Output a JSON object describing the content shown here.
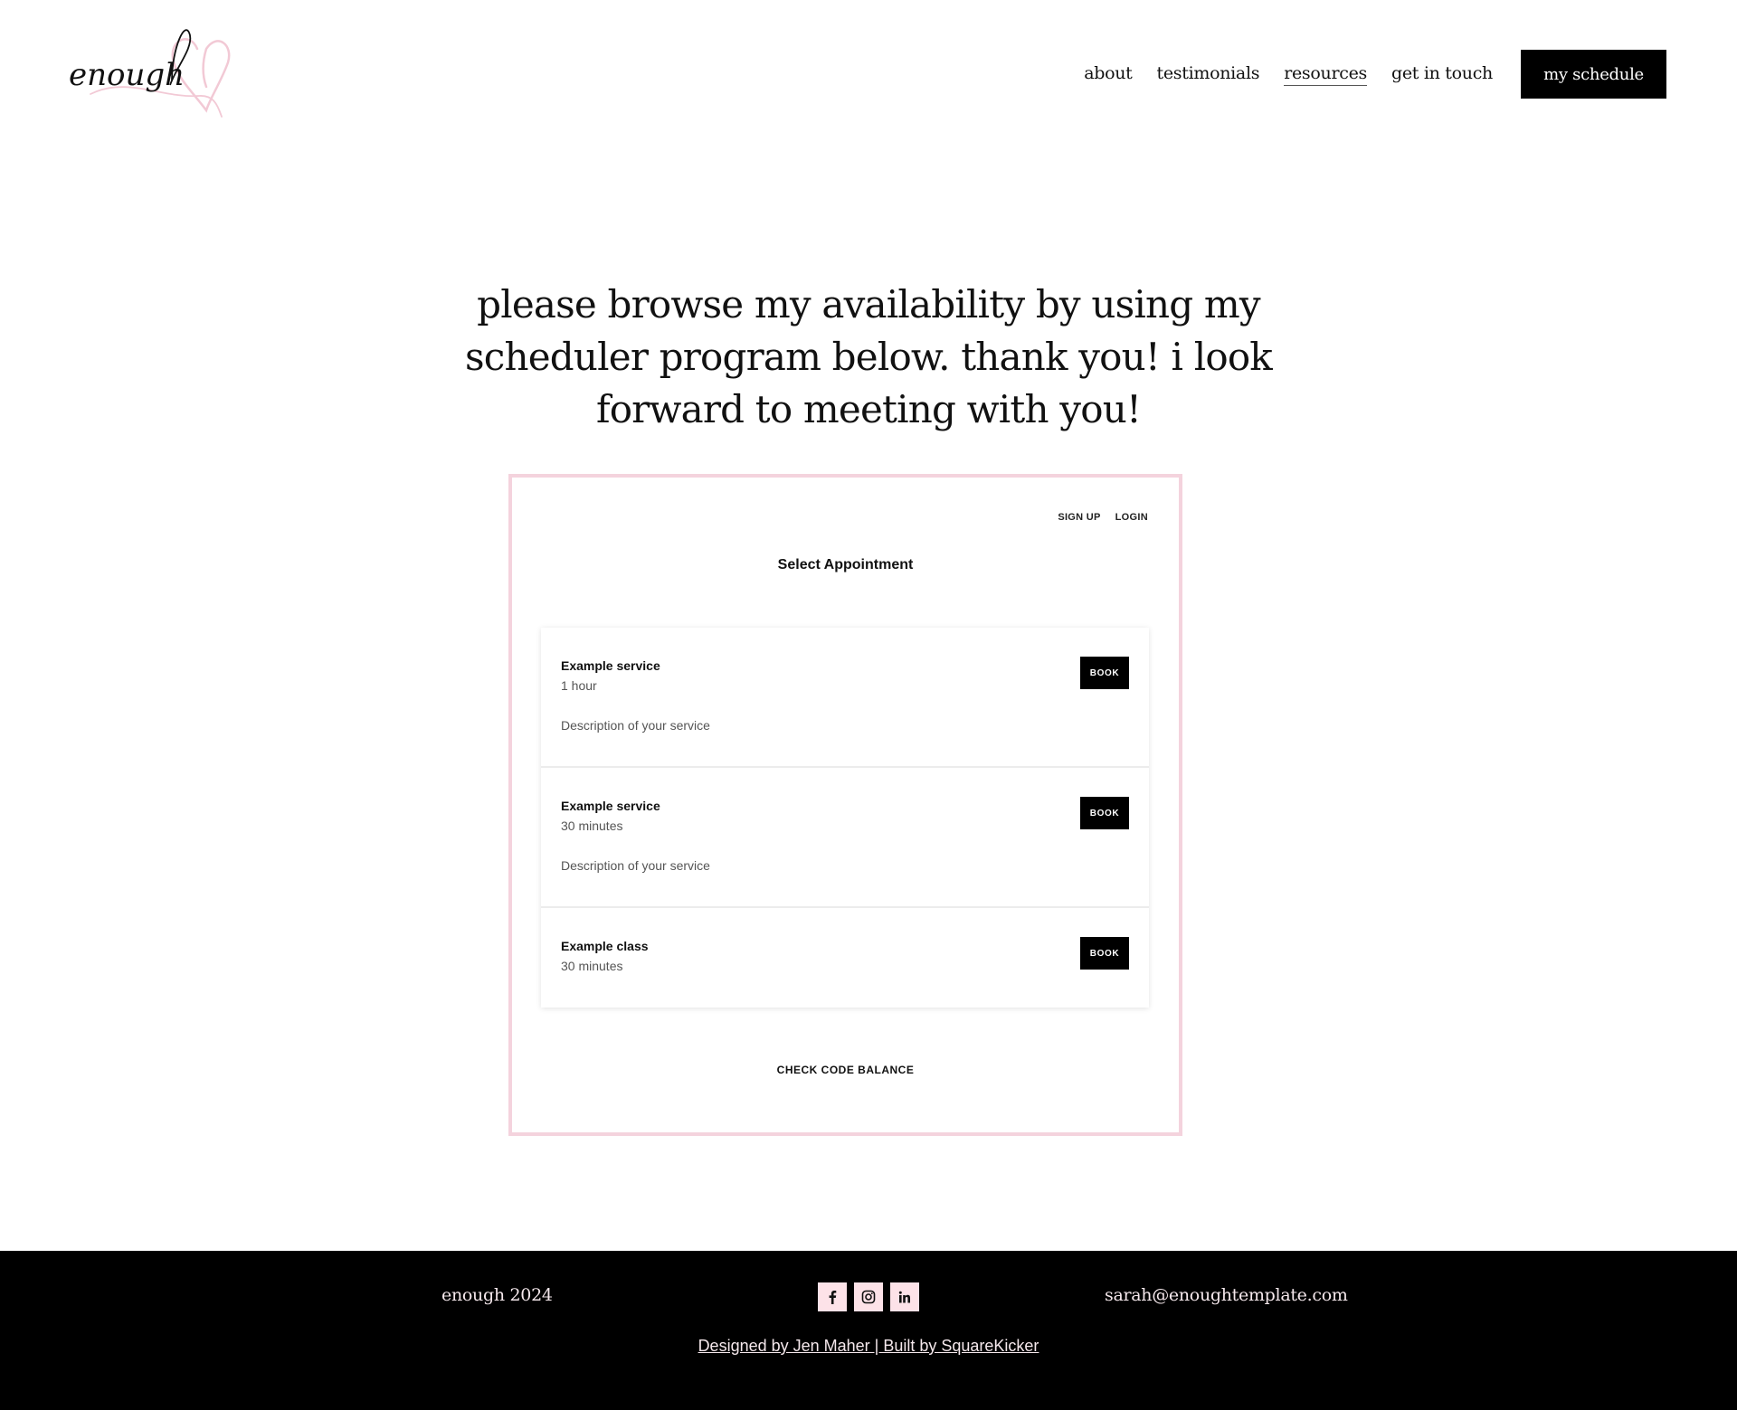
{
  "header": {
    "logo_text": "enough",
    "nav": [
      {
        "label": "about",
        "active": false
      },
      {
        "label": "testimonials",
        "active": false
      },
      {
        "label": "resources",
        "active": true
      },
      {
        "label": "get in touch",
        "active": false
      }
    ],
    "cta_label": "my schedule"
  },
  "intro": {
    "lines": [
      "please browse my availability by using my",
      "scheduler program below. thank you! i look",
      "forward to meeting with you!"
    ]
  },
  "scheduler": {
    "sign_up": "SIGN UP",
    "login": "LOGIN",
    "title": "Select Appointment",
    "services": [
      {
        "name": "Example service",
        "duration": "1 hour",
        "description": "Description of your service",
        "book_label": "BOOK"
      },
      {
        "name": "Example service",
        "duration": "30 minutes",
        "description": "Description of your service",
        "book_label": "BOOK"
      },
      {
        "name": "Example class",
        "duration": "30 minutes",
        "description": "",
        "book_label": "BOOK"
      }
    ],
    "check_code_balance": "CHECK CODE BALANCE"
  },
  "footer": {
    "copyright": "enough 2024",
    "email": "sarah@enoughtemplate.com",
    "social": [
      "facebook-icon",
      "instagram-icon",
      "linkedin-icon"
    ],
    "credit": "Designed by Jen Maher | Built by SquareKicker"
  },
  "colors": {
    "accent_pink": "#f4d3dd",
    "social_bg": "#fde2e8",
    "footer_bg": "#000000"
  }
}
